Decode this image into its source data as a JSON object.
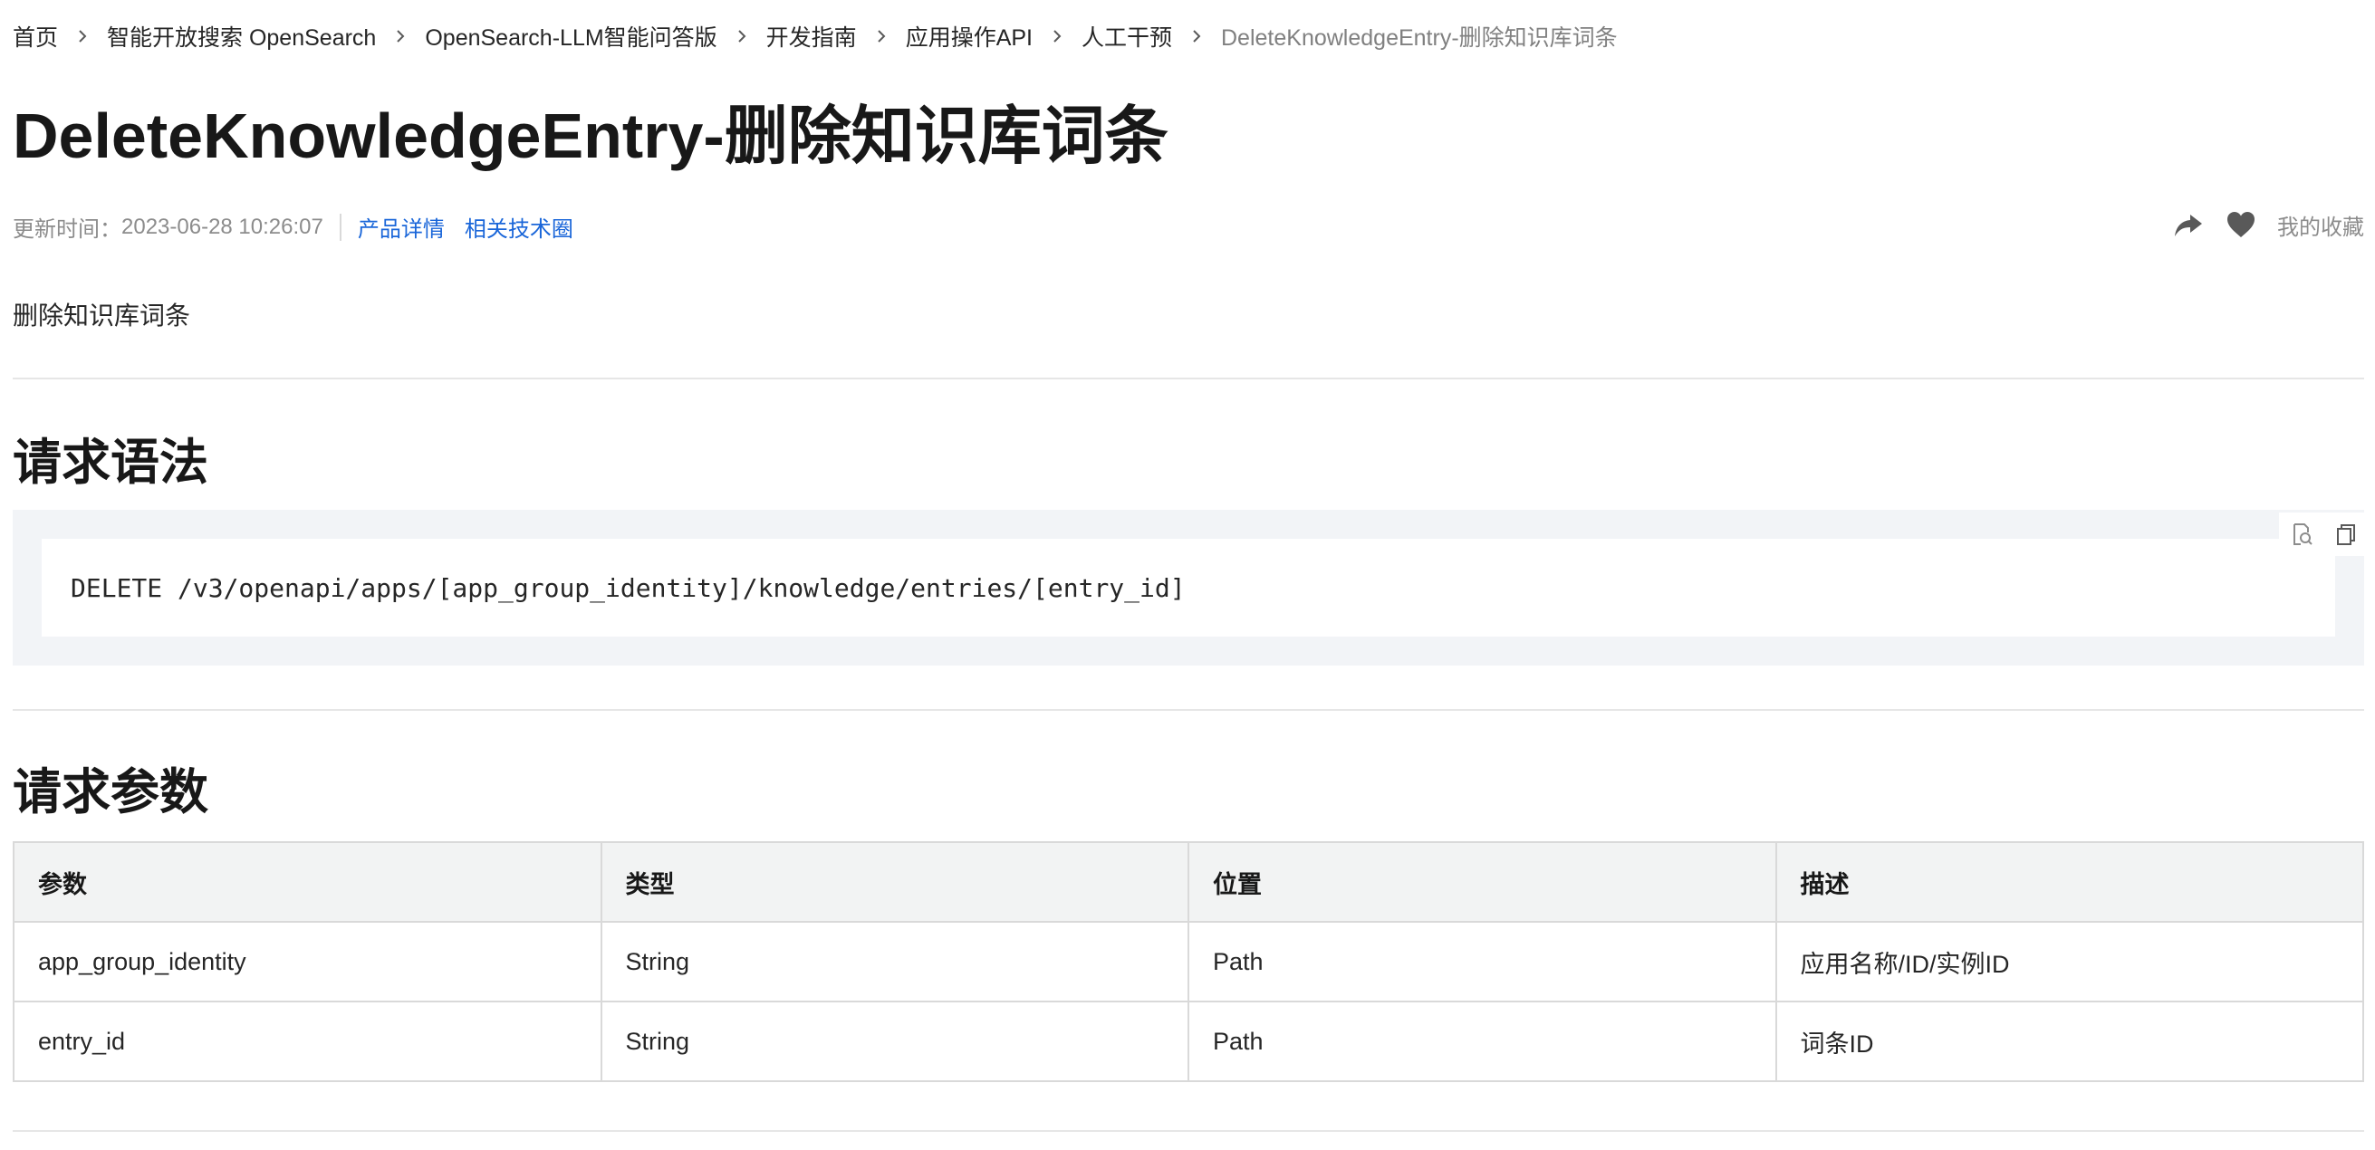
{
  "breadcrumb": [
    {
      "label": "首页"
    },
    {
      "label": "智能开放搜索 OpenSearch"
    },
    {
      "label": "OpenSearch-LLM智能问答版"
    },
    {
      "label": "开发指南"
    },
    {
      "label": "应用操作API"
    },
    {
      "label": "人工干预"
    },
    {
      "label": "DeleteKnowledgeEntry-删除知识库词条"
    }
  ],
  "page_title": "DeleteKnowledgeEntry-删除知识库词条",
  "meta": {
    "updated_label": "更新时间：",
    "updated_value": "2023-06-28 10:26:07",
    "links": [
      "产品详情",
      "相关技术圈"
    ]
  },
  "actions": {
    "share_icon": "share-icon",
    "heart_icon": "heart-icon",
    "favorite_label": "我的收藏"
  },
  "summary": "删除知识库词条",
  "sections": {
    "request_syntax": {
      "heading": "请求语法",
      "code": "DELETE /v3/openapi/apps/[app_group_identity]/knowledge/entries/[entry_id]"
    },
    "request_params": {
      "heading": "请求参数",
      "columns": [
        "参数",
        "类型",
        "位置",
        "描述"
      ],
      "rows": [
        [
          "app_group_identity",
          "String",
          "Path",
          "应用名称/ID/实例ID"
        ],
        [
          "entry_id",
          "String",
          "Path",
          "词条ID"
        ]
      ]
    }
  },
  "colors": {
    "link": "#1a66d9",
    "muted": "#8c8c8c",
    "code_bg": "#f2f4f7",
    "table_header_bg": "#f2f3f3"
  }
}
